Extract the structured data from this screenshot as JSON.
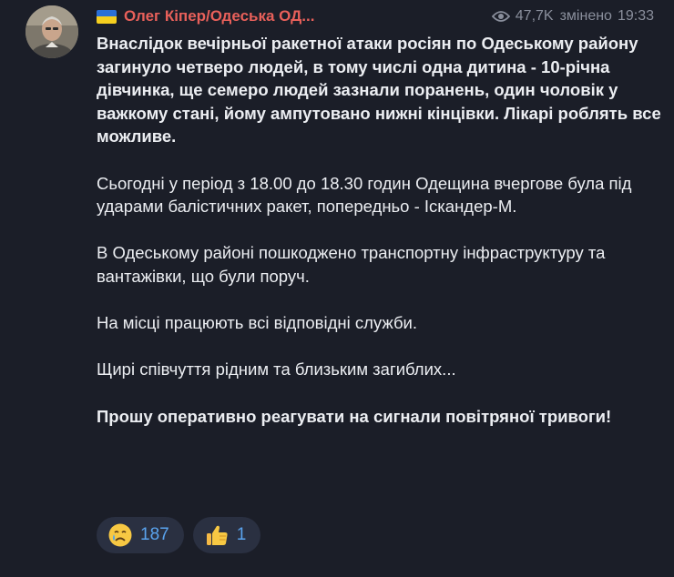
{
  "channel": {
    "flag_icon": "ukraine-flag-icon",
    "name": "Олег Кіпер/Одеська ОД...",
    "name_color": "#e8605a"
  },
  "meta": {
    "views_icon": "eye-icon",
    "views": "47,7K",
    "edited": "змінено",
    "time": "19:33"
  },
  "paragraphs": [
    "Внаслідок вечірньої ракетної атаки росіян по Одеському району загинуло четверо людей, в тому числі одна дитина - 10-річна дівчинка, ще семеро людей зазнали поранень, один чоловік у важкому стані, йому ампутовано нижні кінцівки. Лікарі роблять все можливе.",
    "Сьогодні у період з 18.00 до 18.30 годин Одещина вчергове була під ударами балістичних ракет, попередньо - Іскандер-М.",
    "В Одеському районі пошкоджено транспортну інфраструктуру та вантажівки, що були поруч.",
    "На місці працюють всі відповідні служби.",
    "Щирі співчуття рідним та близьким загиблих...",
    "Прошу оперативно реагувати на сигнали повітряної тривоги!"
  ],
  "reactions": [
    {
      "icon": "crying-face-emoji-icon",
      "count": "187"
    },
    {
      "icon": "thumbs-up-emoji-icon",
      "count": "1"
    }
  ],
  "colors": {
    "background": "#1b1e28",
    "text": "#eceef2",
    "muted": "#8a8f9c",
    "reaction_bg": "#2a3041",
    "reaction_text": "#5aa4ef"
  }
}
